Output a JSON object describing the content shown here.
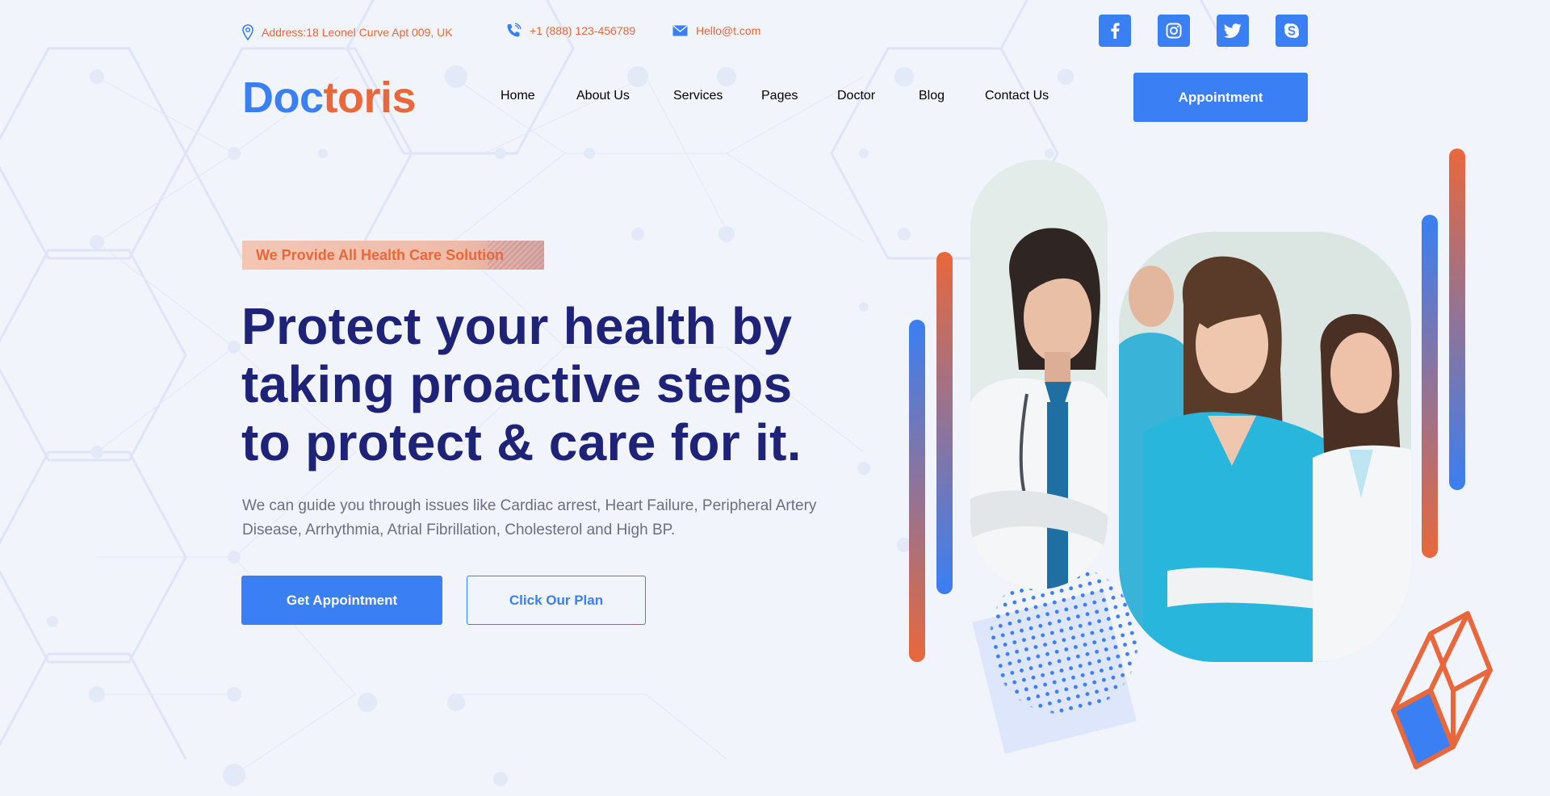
{
  "topbar": {
    "address": "Address:18 Leonel Curve Apt 009, UK",
    "phone": "+1 (888) 123-456789",
    "email": "Hello@t.com",
    "social": [
      "facebook-icon",
      "instagram-icon",
      "twitter-icon",
      "skype-icon"
    ]
  },
  "header": {
    "logo_part1": "Doc",
    "logo_part2": "toris",
    "nav": [
      "Home",
      "About Us",
      "Services",
      "Pages",
      "Doctor",
      "Blog",
      "Contact Us"
    ],
    "cta": "Appointment"
  },
  "hero": {
    "tagline": "We Provide All Health Care Solution",
    "headline": [
      "Protect your health by",
      "taking proactive steps",
      "to protect & care for it."
    ],
    "description": "We can guide you through issues like Cardiac arrest, Heart Failure, Peripheral Artery Disease, Arrhythmia, Atrial Fibrillation, Cholesterol and High BP.",
    "primary_button": "Get Appointment",
    "secondary_button": "Click Our Plan"
  },
  "colors": {
    "primary": "#3a7ff3",
    "accent": "#e8683b",
    "heading": "#1e2378",
    "background": "#f2f4fb"
  }
}
